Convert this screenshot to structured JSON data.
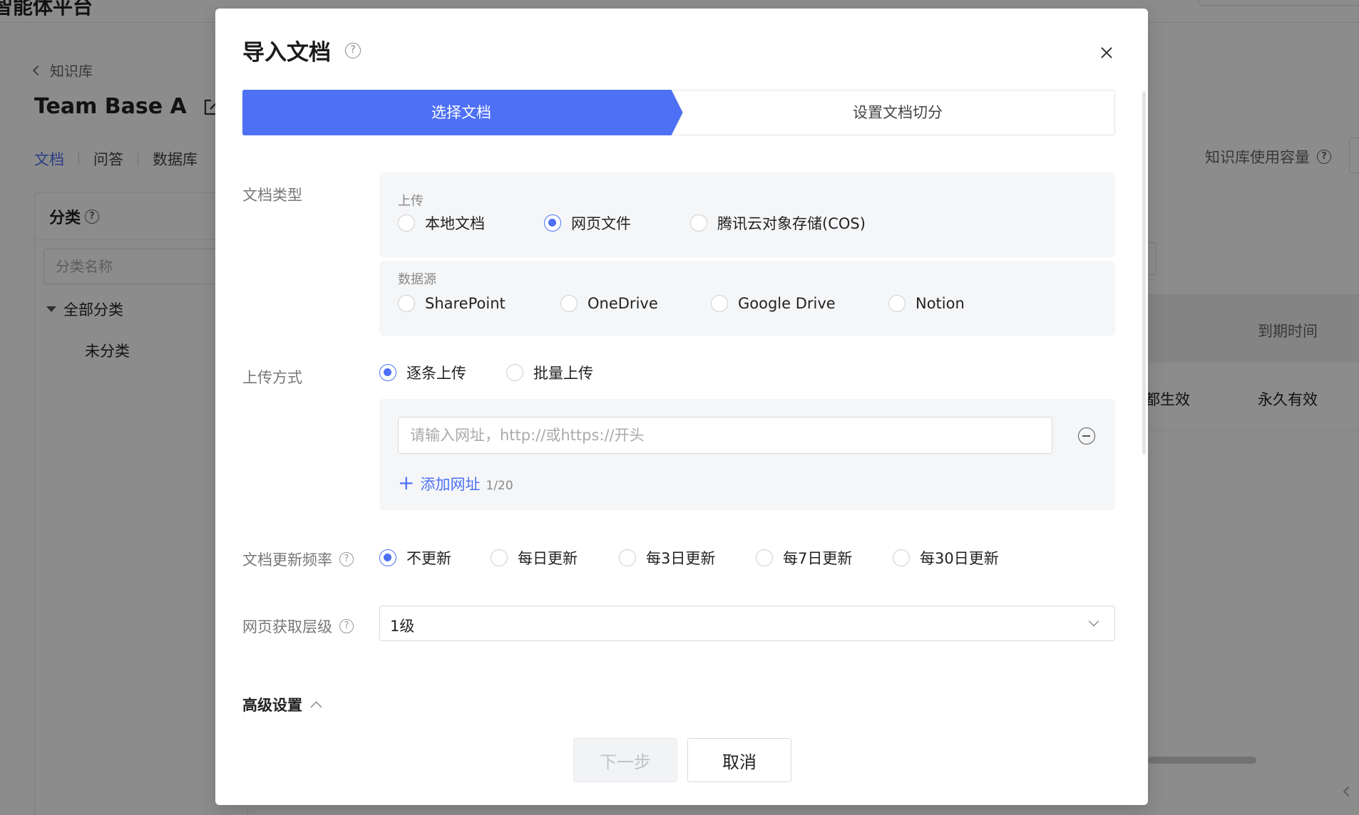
{
  "background": {
    "app_title": "智能体平台",
    "back_link": "知识库",
    "kb_name": "Team Base A",
    "tabs": [
      {
        "label": "文档",
        "active": true
      },
      {
        "label": "问答",
        "active": false
      },
      {
        "label": "数据库",
        "active": false
      }
    ],
    "sidebar": {
      "heading": "分类",
      "search_placeholder": "分类名称",
      "all_label": "全部分类",
      "uncategorized_label": "未分类"
    },
    "capacity_label": "知识库使用容量",
    "table": {
      "header_expire": "到期时间",
      "row_scope": "都生效",
      "row_expire": "永久有效"
    }
  },
  "modal": {
    "title": "导入文档",
    "steps": [
      {
        "label": "选择文档",
        "active": true
      },
      {
        "label": "设置文档切分",
        "active": false
      }
    ],
    "doc_type": {
      "label": "文档类型",
      "upload_group": {
        "title": "上传",
        "options": [
          {
            "label": "本地文档",
            "checked": false
          },
          {
            "label": "网页文件",
            "checked": true
          },
          {
            "label": "腾讯云对象存储(COS)",
            "checked": false
          }
        ]
      },
      "datasource_group": {
        "title": "数据源",
        "options": [
          {
            "label": "SharePoint",
            "checked": false
          },
          {
            "label": "OneDrive",
            "checked": false
          },
          {
            "label": "Google Drive",
            "checked": false
          },
          {
            "label": "Notion",
            "checked": false
          }
        ]
      }
    },
    "upload_mode": {
      "label": "上传方式",
      "options": [
        {
          "label": "逐条上传",
          "checked": true
        },
        {
          "label": "批量上传",
          "checked": false
        }
      ]
    },
    "url_panel": {
      "input_value": "",
      "input_placeholder": "请输入网址，http://或https://开头",
      "add_label": "添加网址",
      "count": "1/20"
    },
    "update_freq": {
      "label": "文档更新频率",
      "options": [
        {
          "label": "不更新",
          "checked": true
        },
        {
          "label": "每日更新",
          "checked": false
        },
        {
          "label": "每3日更新",
          "checked": false
        },
        {
          "label": "每7日更新",
          "checked": false
        },
        {
          "label": "每30日更新",
          "checked": false
        }
      ]
    },
    "crawl_level": {
      "label": "网页获取层级",
      "selected": "1级"
    },
    "advanced_label": "高级设置",
    "buttons": {
      "next": "下一步",
      "cancel": "取消"
    },
    "accent_color": "#4d70f5"
  }
}
